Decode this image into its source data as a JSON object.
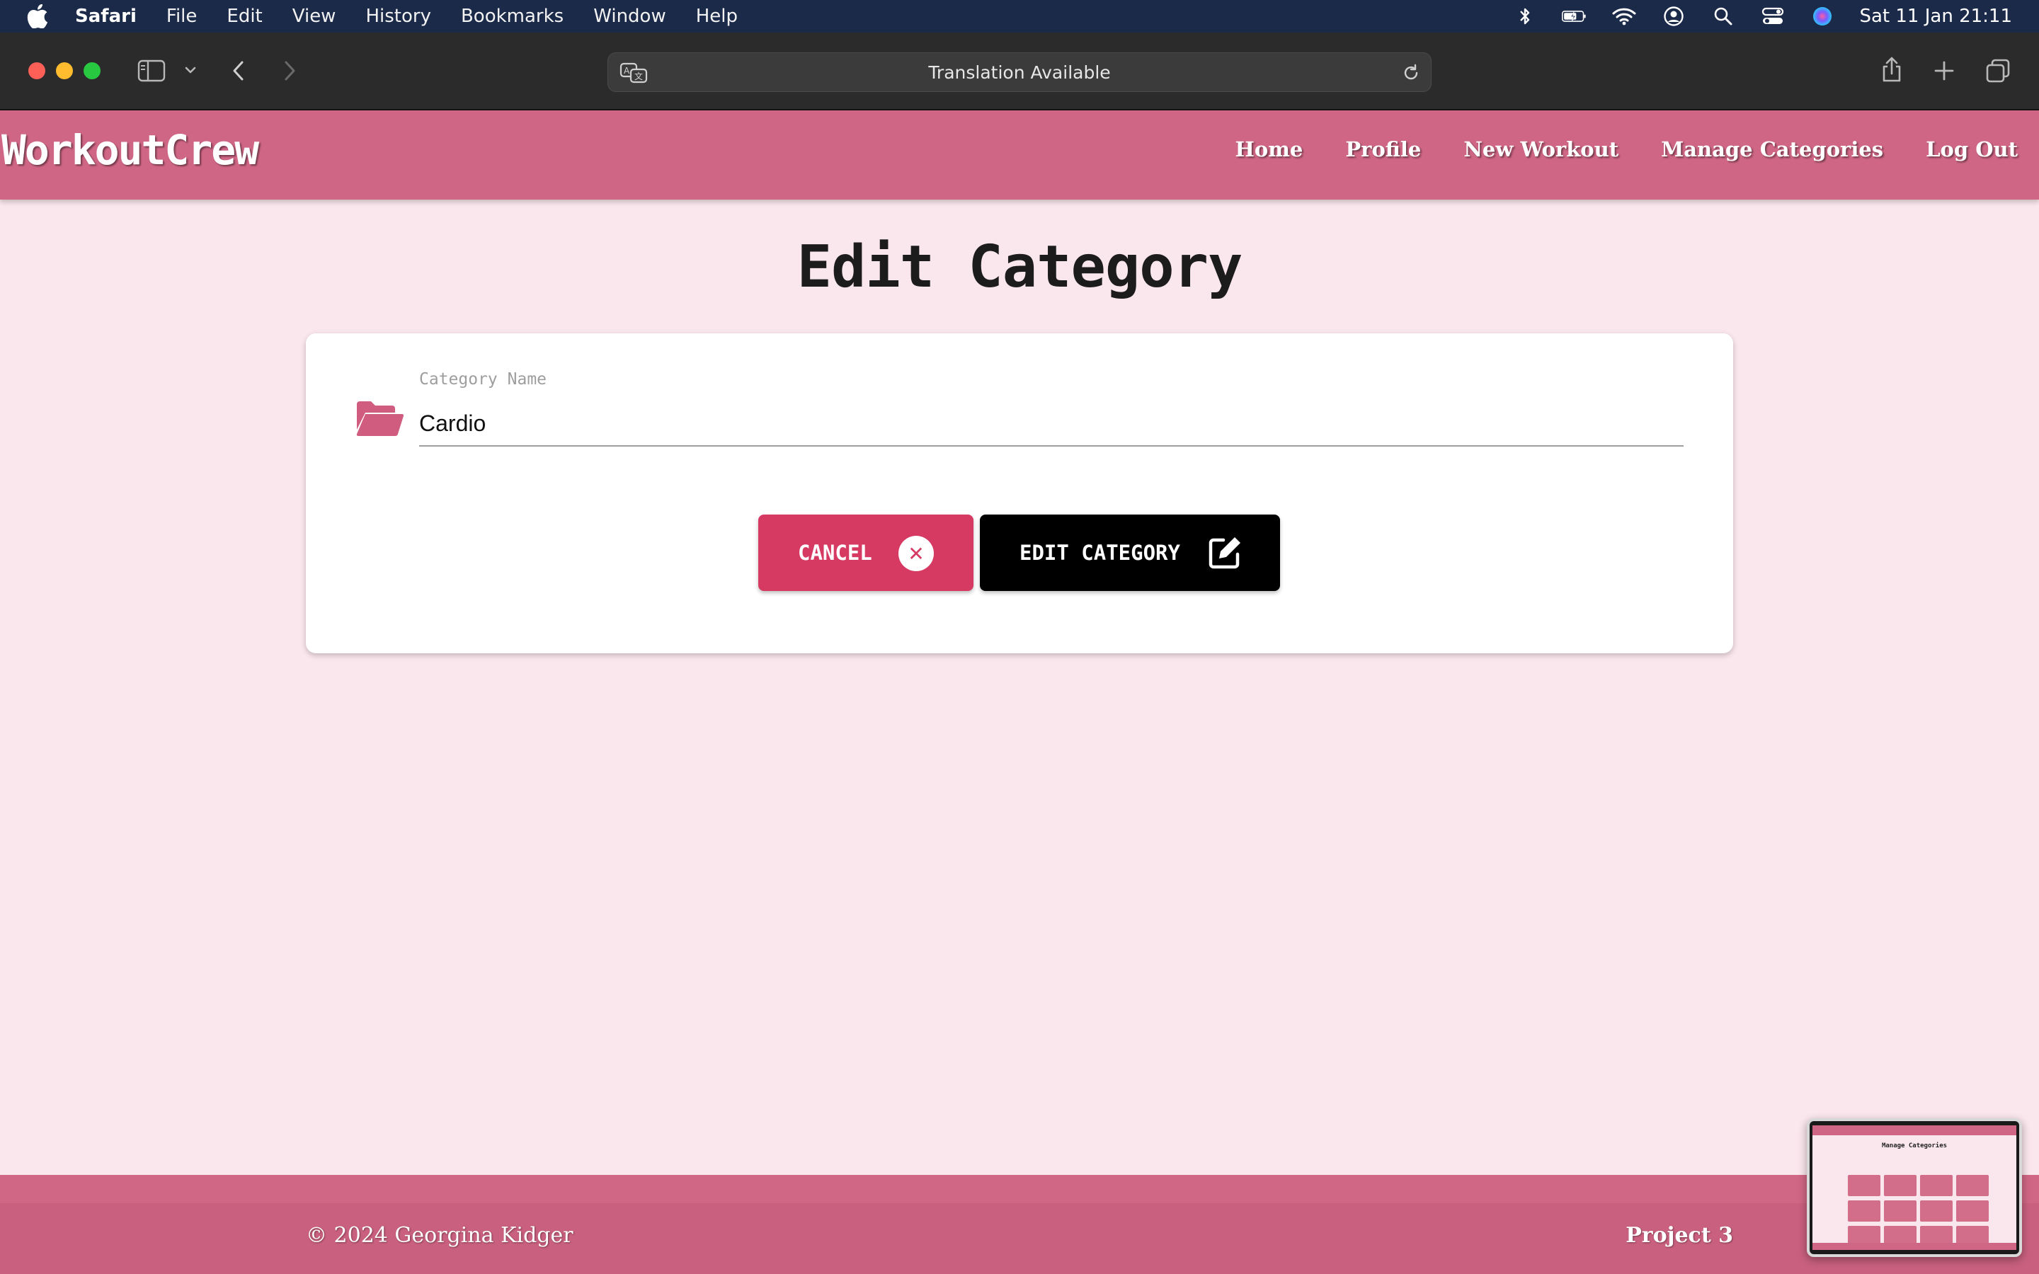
{
  "menubar": {
    "app_name": "Safari",
    "items": [
      "File",
      "Edit",
      "View",
      "History",
      "Bookmarks",
      "Window",
      "Help"
    ],
    "clock": "Sat 11 Jan  21:11",
    "status_icons": [
      "bluetooth-icon",
      "battery-icon",
      "wifi-icon",
      "user-icon",
      "spotlight-icon",
      "control-center-icon",
      "siri-icon"
    ]
  },
  "browser": {
    "address_text": "Translation Available"
  },
  "site": {
    "logo": "WorkoutCrew",
    "nav": [
      "Home",
      "Profile",
      "New Workout",
      "Manage Categories",
      "Log Out"
    ]
  },
  "main": {
    "title": "Edit Category",
    "field": {
      "label": "Category Name",
      "value": "Cardio"
    },
    "buttons": {
      "cancel": "CANCEL",
      "edit": "EDIT CATEGORY"
    }
  },
  "footer": {
    "copyright": "© 2024 Georgina Kidger",
    "project": "Project 3"
  },
  "thumbnail": {
    "title": "Manage Categories"
  },
  "colors": {
    "accent": "#cf6685",
    "cancel": "#d63a63",
    "background": "#fae6ed"
  }
}
